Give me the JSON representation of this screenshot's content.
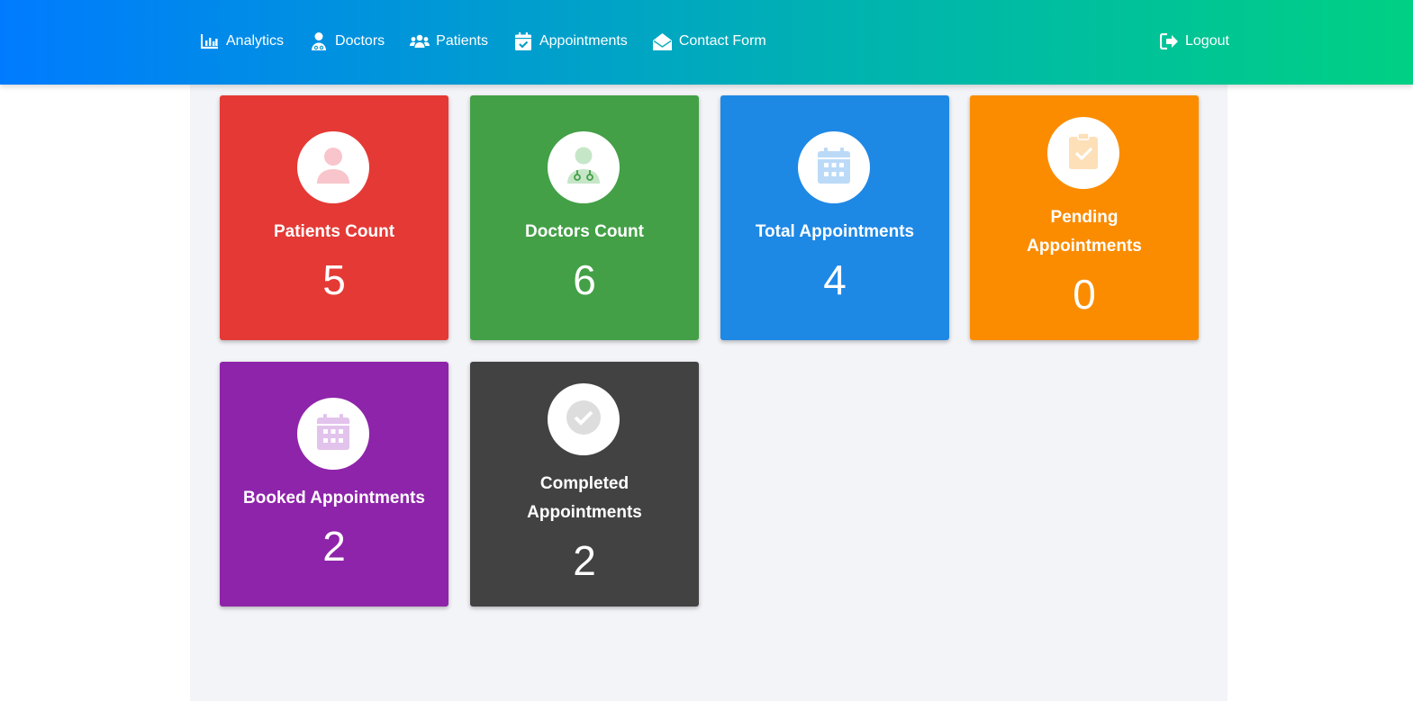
{
  "nav": {
    "items": [
      {
        "label": "Analytics",
        "icon": "chart-bar-icon"
      },
      {
        "label": "Doctors",
        "icon": "user-doctor-icon"
      },
      {
        "label": "Patients",
        "icon": "users-icon"
      },
      {
        "label": "Appointments",
        "icon": "calendar-check-icon"
      },
      {
        "label": "Contact Form",
        "icon": "envelope-open-icon"
      }
    ],
    "logout": {
      "label": "Logout",
      "icon": "sign-out-icon"
    }
  },
  "cards": [
    {
      "label": "Patients Count",
      "value": "5",
      "color": "#e53935",
      "icon": "user-icon",
      "icon_color": "#f8c5cc"
    },
    {
      "label": "Doctors Count",
      "value": "6",
      "color": "#43a047",
      "icon": "user-doctor-icon",
      "icon_color": "#c6e6c8"
    },
    {
      "label": "Total Appointments",
      "value": "4",
      "color": "#1e88e5",
      "icon": "calendar-icon",
      "icon_color": "#bbdaf7"
    },
    {
      "label": "Pending Appointments",
      "value": "0",
      "color": "#fb8c00",
      "icon": "clipboard-check-icon",
      "icon_color": "#fde0b8"
    },
    {
      "label": "Booked Appointments",
      "value": "2",
      "color": "#8e24aa",
      "icon": "calendar-icon",
      "icon_color": "#e2c3ec"
    },
    {
      "label": "Completed Appointments",
      "value": "2",
      "color": "#424242",
      "icon": "check-circle-icon",
      "icon_color": "#dddddd"
    }
  ]
}
